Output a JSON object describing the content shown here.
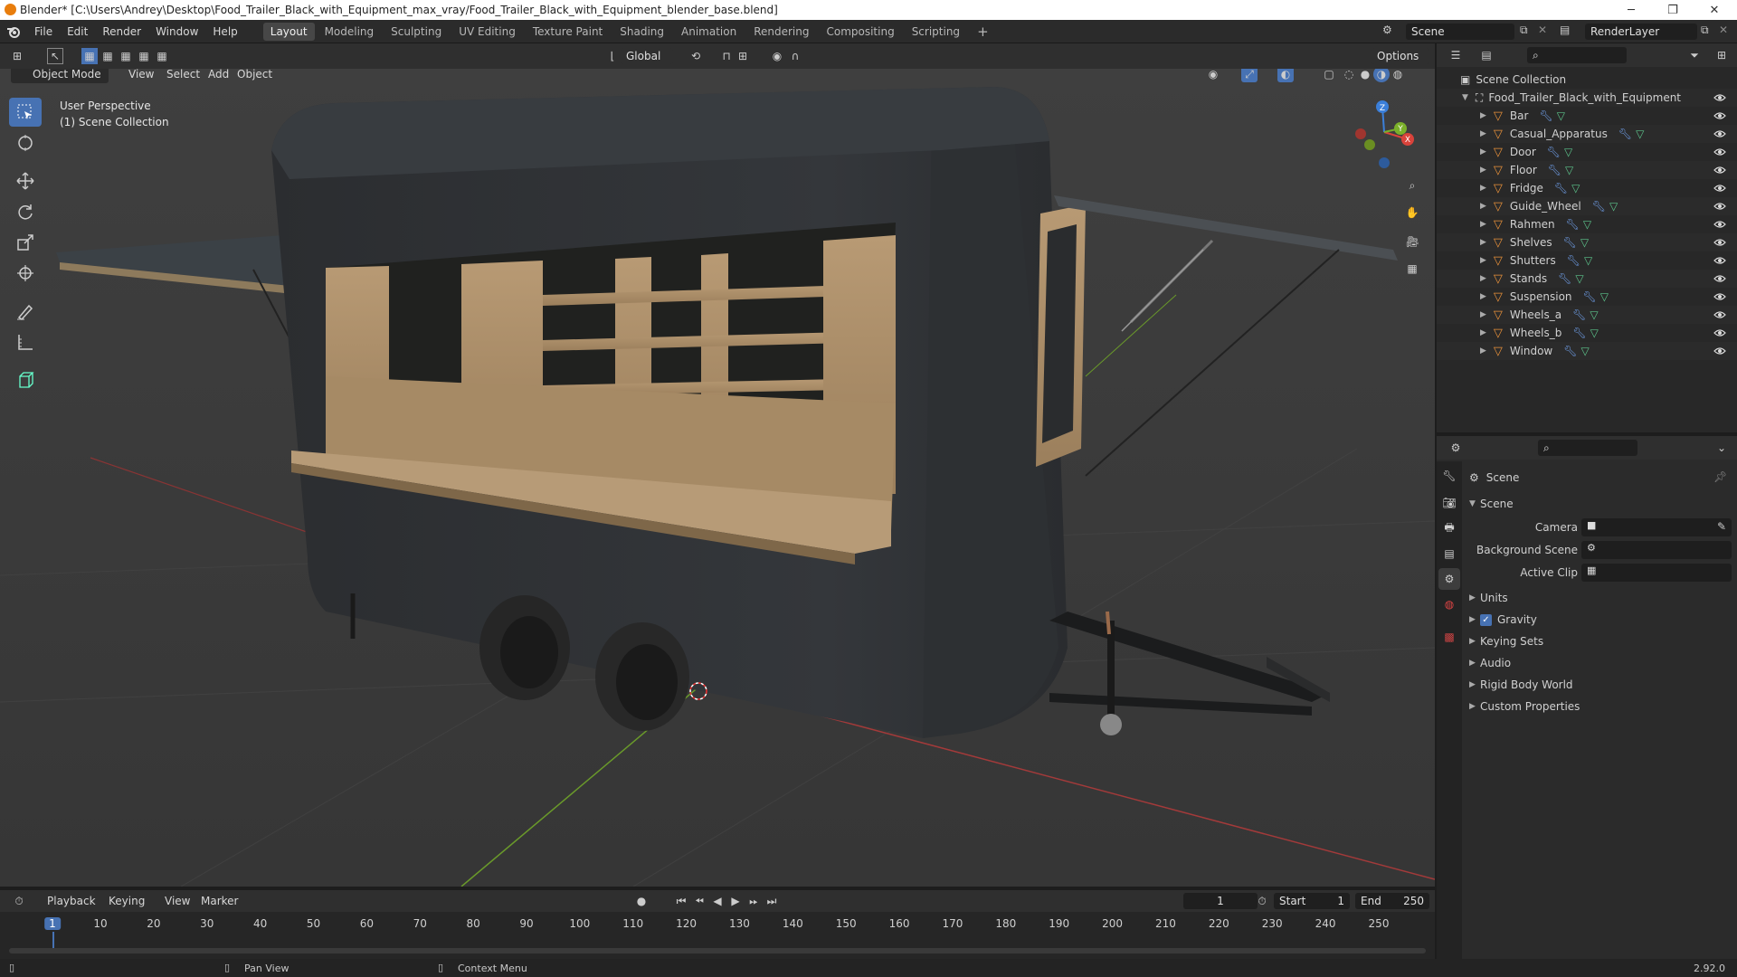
{
  "window": {
    "title": "Blender* [C:\\Users\\Andrey\\Desktop\\Food_Trailer_Black_with_Equipment_max_vray/Food_Trailer_Black_with_Equipment_blender_base.blend]",
    "minimize": "─",
    "maximize": "❐",
    "close": "✕"
  },
  "menu": [
    "File",
    "Edit",
    "Render",
    "Window",
    "Help"
  ],
  "workspaces": [
    {
      "label": "Layout",
      "active": true
    },
    {
      "label": "Modeling"
    },
    {
      "label": "Sculpting"
    },
    {
      "label": "UV Editing"
    },
    {
      "label": "Texture Paint"
    },
    {
      "label": "Shading"
    },
    {
      "label": "Animation"
    },
    {
      "label": "Rendering"
    },
    {
      "label": "Compositing"
    },
    {
      "label": "Scripting"
    }
  ],
  "add_workspace": "+",
  "scene_name": "Scene",
  "view_layer": "RenderLayer",
  "viewport_header": {
    "mode": "Object Mode",
    "menus": [
      "View",
      "Select",
      "Add",
      "Object"
    ],
    "transform_orientation": "Global",
    "options": "Options"
  },
  "viewport": {
    "perspective": "User Perspective",
    "collection": "(1) Scene Collection",
    "gizmo_axes": [
      "X",
      "Y",
      "Z"
    ]
  },
  "outliner": {
    "root": "Scene Collection",
    "collection": "Food_Trailer_Black_with_Equipment",
    "objects": [
      "Bar",
      "Casual_Apparatus",
      "Door",
      "Floor",
      "Fridge",
      "Guide_Wheel",
      "Rahmen",
      "Shelves",
      "Shutters",
      "Stands",
      "Suspension",
      "Wheels_a",
      "Wheels_b",
      "Window"
    ]
  },
  "properties": {
    "context": "Scene",
    "panel": "Scene",
    "fields": [
      {
        "label": "Camera"
      },
      {
        "label": "Background Scene"
      },
      {
        "label": "Active Clip"
      }
    ],
    "subpanels": [
      {
        "label": "Units",
        "checkbox": false
      },
      {
        "label": "Gravity",
        "checkbox": true
      },
      {
        "label": "Keying Sets",
        "checkbox": false
      },
      {
        "label": "Audio",
        "checkbox": false
      },
      {
        "label": "Rigid Body World",
        "checkbox": false
      },
      {
        "label": "Custom Properties",
        "checkbox": false
      }
    ]
  },
  "timeline": {
    "menus": [
      "Playback",
      "Keying",
      "View",
      "Marker"
    ],
    "current_frame": "1",
    "start_label": "Start",
    "start": "1",
    "end_label": "End",
    "end": "250",
    "ticks": [
      "1",
      "10",
      "20",
      "30",
      "40",
      "50",
      "60",
      "70",
      "80",
      "90",
      "100",
      "110",
      "120",
      "130",
      "140",
      "150",
      "160",
      "170",
      "180",
      "190",
      "200",
      "210",
      "220",
      "230",
      "240",
      "250"
    ]
  },
  "statusbar": {
    "pan": "Pan View",
    "context": "Context Menu",
    "version": "2.92.0"
  },
  "colors": {
    "accent": "#4772b3",
    "object_icon": "#e8913a",
    "modifier_icon": "#6f9ee8",
    "mesh_icon": "#5cc28a"
  }
}
